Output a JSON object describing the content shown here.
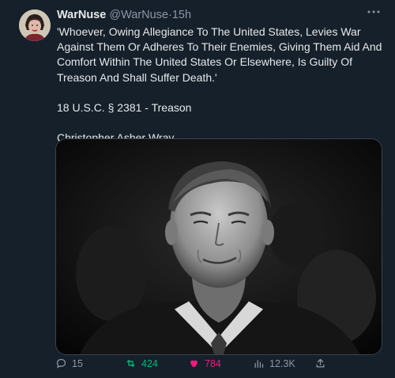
{
  "tweet": {
    "author_name": "WarNuse",
    "author_handle": "@WarNuse",
    "separator": "·",
    "time_ago": "15h",
    "quote_text": "'Whoever, Owing Allegiance To The United States, Levies War Against Them Or Adheres To Their Enemies, Giving Them Aid And Comfort Within The United States Or Elsewhere, Is Guilty Of Treason And Shall Suffer Death.'",
    "citation": "18 U.S.C. § 2381 - Treason",
    "subject": "Christopher Asher Wray"
  },
  "actions": {
    "replies": "15",
    "retweets": "424",
    "likes": "784",
    "views": "12.3K"
  },
  "icons": {
    "more": "more-options-icon",
    "reply": "reply-icon",
    "retweet": "retweet-icon",
    "like": "heart-icon",
    "views": "views-bar-chart-icon",
    "share": "share-icon"
  },
  "colors": {
    "background": "#15202b",
    "text": "#e7e9ea",
    "muted": "#8b98a5",
    "retweet": "#00ba7c",
    "like": "#f91880"
  }
}
